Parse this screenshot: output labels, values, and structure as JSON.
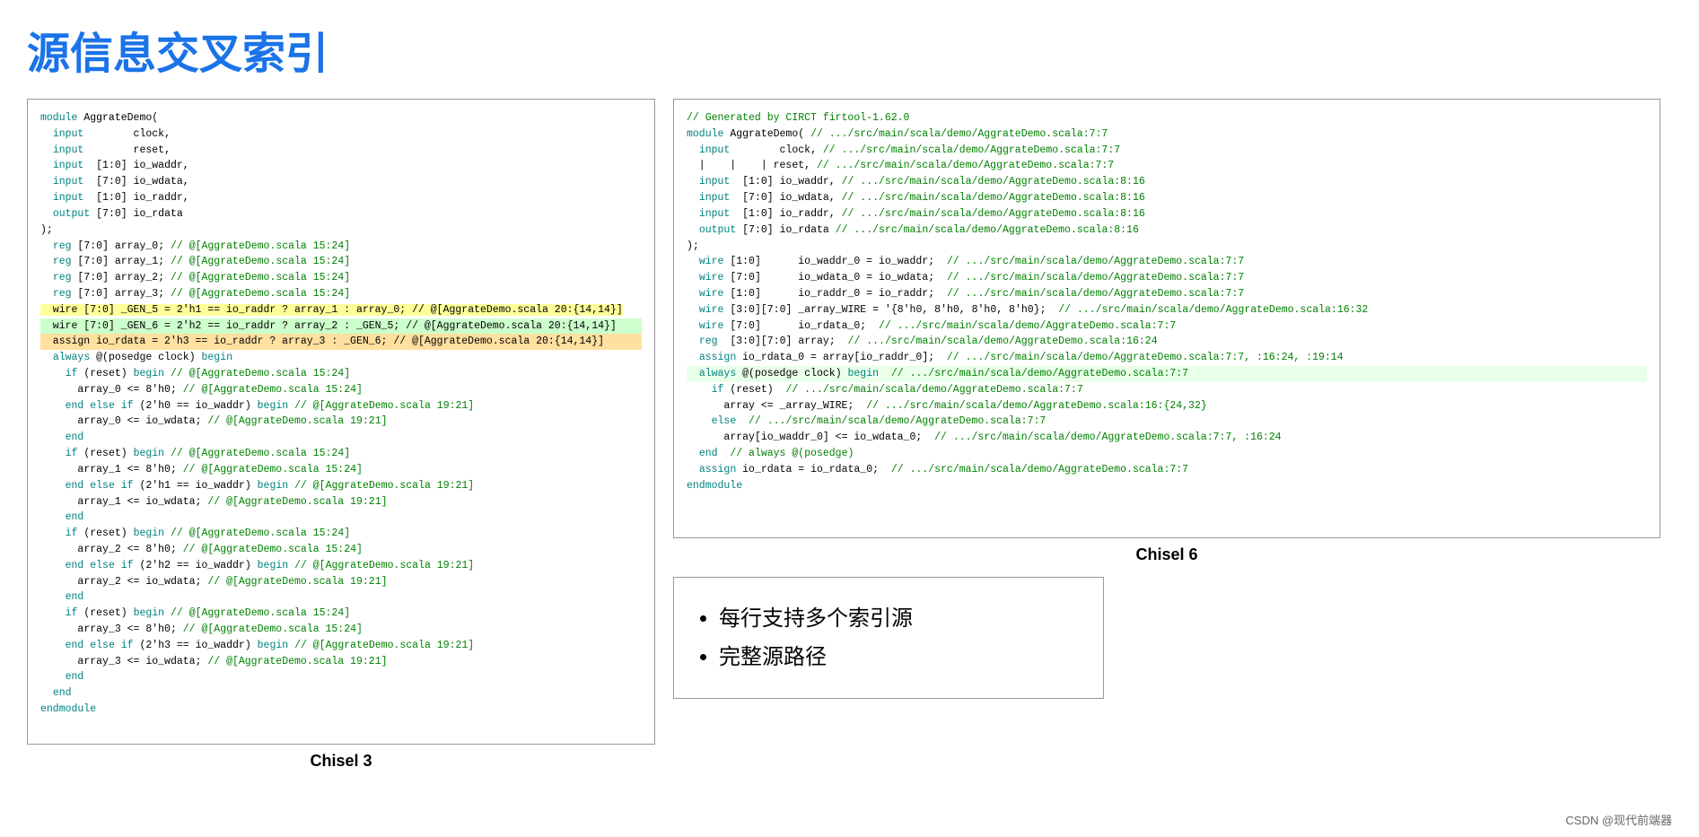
{
  "title": "源信息交叉索引",
  "left_panel": {
    "caption": "Chisel 3",
    "code_lines": [
      {
        "text": "module AggrateDemo(",
        "type": "normal"
      },
      {
        "text": "  input        clock,",
        "type": "normal"
      },
      {
        "text": "  input        reset,",
        "type": "normal"
      },
      {
        "text": "  input  [1:0] io_waddr,",
        "type": "normal"
      },
      {
        "text": "  input  [7:0] io_wdata,",
        "type": "normal"
      },
      {
        "text": "  input  [1:0] io_raddr,",
        "type": "normal"
      },
      {
        "text": "  output [7:0] io_rdata",
        "type": "normal"
      },
      {
        "text": ");",
        "type": "normal"
      },
      {
        "text": "  reg [7:0] array_0; // @[AggrateDemo.scala 15:24]",
        "type": "comment_partial"
      },
      {
        "text": "  reg [7:0] array_1; // @[AggrateDemo.scala 15:24]",
        "type": "comment_partial"
      },
      {
        "text": "  reg [7:0] array_2; // @[AggrateDemo.scala 15:24]",
        "type": "comment_partial"
      },
      {
        "text": "  reg [7:0] array_3; // @[AggrateDemo.scala 15:24]",
        "type": "comment_partial"
      },
      {
        "text": "  wire [7:0] _GEN_5 = 2'h1 == io_raddr ? array_1 : array_0; // @[AggrateDemo.scala 20:{14,14}]",
        "type": "highlight_yellow"
      },
      {
        "text": "  wire [7:0] _GEN_6 = 2'h2 == io_raddr ? array_2 : _GEN_5; // @[AggrateDemo.scala 20:{14,14}]",
        "type": "highlight_green"
      },
      {
        "text": "  assign io_rdata = 2'h3 == io_raddr ? array_3 : _GEN_6; // @[AggrateDemo.scala 20:{14,14}]",
        "type": "highlight_orange"
      },
      {
        "text": "  always @(posedge clock) begin",
        "type": "normal"
      },
      {
        "text": "    if (reset) begin // @[AggrateDemo.scala 15:24]",
        "type": "comment_partial"
      },
      {
        "text": "      array_0 <= 8'h0; // @[AggrateDemo.scala 15:24]",
        "type": "comment_partial"
      },
      {
        "text": "    end else if (2'h0 == io_waddr) begin // @[AggrateDemo.scala 19:21]",
        "type": "comment_partial"
      },
      {
        "text": "      array_0 <= io_wdata; // @[AggrateDemo.scala 19:21]",
        "type": "comment_partial"
      },
      {
        "text": "    end",
        "type": "normal"
      },
      {
        "text": "    if (reset) begin // @[AggrateDemo.scala 15:24]",
        "type": "comment_partial"
      },
      {
        "text": "      array_1 <= 8'h0; // @[AggrateDemo.scala 15:24]",
        "type": "comment_partial"
      },
      {
        "text": "    end else if (2'h1 == io_waddr) begin // @[AggrateDemo.scala 19:21]",
        "type": "comment_partial"
      },
      {
        "text": "      array_1 <= io_wdata; // @[AggrateDemo.scala 19:21]",
        "type": "comment_partial"
      },
      {
        "text": "    end",
        "type": "normal"
      },
      {
        "text": "    if (reset) begin // @[AggrateDemo.scala 15:24]",
        "type": "comment_partial"
      },
      {
        "text": "      array_2 <= 8'h0; // @[AggrateDemo.scala 15:24]",
        "type": "comment_partial"
      },
      {
        "text": "    end else if (2'h2 == io_waddr) begin // @[AggrateDemo.scala 19:21]",
        "type": "comment_partial"
      },
      {
        "text": "      array_2 <= io_wdata; // @[AggrateDemo.scala 19:21]",
        "type": "comment_partial"
      },
      {
        "text": "    end",
        "type": "normal"
      },
      {
        "text": "    if (reset) begin // @[AggrateDemo.scala 15:24]",
        "type": "comment_partial"
      },
      {
        "text": "      array_3 <= 8'h0; // @[AggrateDemo.scala 15:24]",
        "type": "comment_partial"
      },
      {
        "text": "    end else if (2'h3 == io_waddr) begin // @[AggrateDemo.scala 19:21]",
        "type": "comment_partial"
      },
      {
        "text": "      array_3 <= io_wdata; // @[AggrateDemo.scala 19:21]",
        "type": "comment_partial"
      },
      {
        "text": "    end",
        "type": "normal"
      },
      {
        "text": "  end",
        "type": "normal"
      },
      {
        "text": "endmodule",
        "type": "normal"
      }
    ]
  },
  "right_panel": {
    "caption": "Chisel 6",
    "code_lines": [
      {
        "text": "// Generated by CIRCT firtool-1.62.0",
        "type": "comment"
      },
      {
        "text": "module AggrateDemo( // .../src/main/scala/demo/AggrateDemo.scala:7:7",
        "type": "comment_partial"
      },
      {
        "text": "  input        clock, // .../src/main/scala/demo/AggrateDemo.scala:7:7",
        "type": "comment_partial"
      },
      {
        "text": "  |    |    | reset, // .../src/main/scala/demo/AggrateDemo.scala:7:7",
        "type": "comment_partial"
      },
      {
        "text": "  input  [1:0] io_waddr, // .../src/main/scala/demo/AggrateDemo.scala:8:16",
        "type": "comment_partial"
      },
      {
        "text": "  input  [7:0] io_wdata, // .../src/main/scala/demo/AggrateDemo.scala:8:16",
        "type": "comment_partial"
      },
      {
        "text": "  input  [1:0] io_raddr, // .../src/main/scala/demo/AggrateDemo.scala:8:16",
        "type": "comment_partial"
      },
      {
        "text": "  output [7:0] io_rdata // .../src/main/scala/demo/AggrateDemo.scala:8:16",
        "type": "comment_partial"
      },
      {
        "text": ");",
        "type": "normal"
      },
      {
        "text": "",
        "type": "normal"
      },
      {
        "text": "  wire [1:0]      io_waddr_0 = io_waddr;  // .../src/main/scala/demo/AggrateDemo.scala:7:7",
        "type": "comment_partial"
      },
      {
        "text": "  wire [7:0]      io_wdata_0 = io_wdata;  // .../src/main/scala/demo/AggrateDemo.scala:7:7",
        "type": "comment_partial"
      },
      {
        "text": "  wire [1:0]      io_raddr_0 = io_raddr;  // .../src/main/scala/demo/AggrateDemo.scala:7:7",
        "type": "comment_partial"
      },
      {
        "text": "  wire [3:0][7:0] _array_WIRE = '{8'h0, 8'h0, 8'h0, 8'h0};  // .../src/main/scala/demo/AggrateDemo.scala:16:32",
        "type": "comment_partial"
      },
      {
        "text": "  wire [7:0]      io_rdata_0;  // .../src/main/scala/demo/AggrateDemo.scala:7:7",
        "type": "comment_partial"
      },
      {
        "text": "  reg  [3:0][7:0] array;  // .../src/main/scala/demo/AggrateDemo.scala:16:24",
        "type": "comment_partial"
      },
      {
        "text": "  assign io_rdata_0 = array[io_raddr_0];  // .../src/main/scala/demo/AggrateDemo.scala:7:7, :16:24, :19:14",
        "type": "comment_partial"
      },
      {
        "text": "  always @(posedge clock) begin  // .../src/main/scala/demo/AggrateDemo.scala:7:7",
        "type": "highlight_green_right"
      },
      {
        "text": "    if (reset)  // .../src/main/scala/demo/AggrateDemo.scala:7:7",
        "type": "comment_partial"
      },
      {
        "text": "      array <= _array_WIRE;  // .../src/main/scala/demo/AggrateDemo.scala:16:{24,32}",
        "type": "comment_partial"
      },
      {
        "text": "    else  // .../src/main/scala/demo/AggrateDemo.scala:7:7",
        "type": "comment_partial"
      },
      {
        "text": "      array[io_waddr_0] <= io_wdata_0;  // .../src/main/scala/demo/AggrateDemo.scala:7:7, :16:24",
        "type": "comment_partial"
      },
      {
        "text": "  end  // always @(posedge)",
        "type": "comment_partial"
      },
      {
        "text": "  assign io_rdata = io_rdata_0;  // .../src/main/scala/demo/AggrateDemo.scala:7:7",
        "type": "comment_partial"
      },
      {
        "text": "endmodule",
        "type": "normal"
      }
    ]
  },
  "bullets": {
    "items": [
      "每行支持多个索引源",
      "完整源路径"
    ]
  },
  "footer": "CSDN @现代前端器"
}
